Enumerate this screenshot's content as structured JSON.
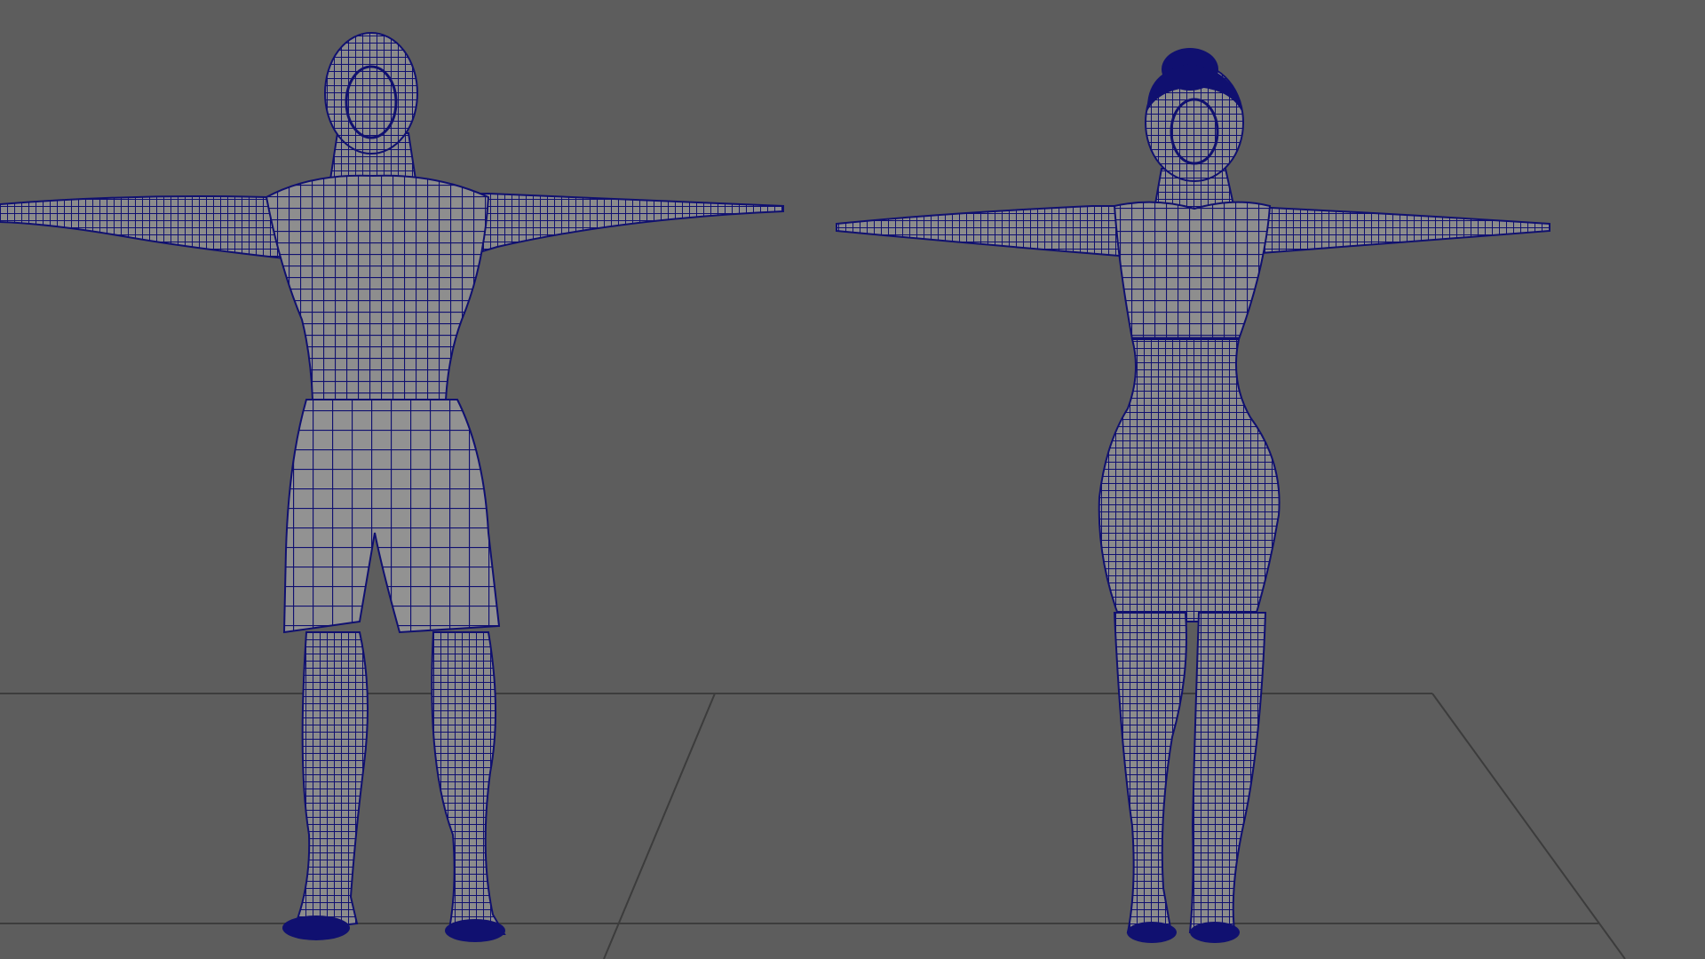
{
  "viewport": {
    "panel": "perspective-viewport",
    "display_mode": "wireframe-on-shaded",
    "background_color": "#5d5d5d",
    "grid_color": "#3c3c3c",
    "mesh_fill_color": "#8e8e8e",
    "wire_color": "#101070"
  },
  "scene": {
    "models": [
      {
        "id": "male-character",
        "pose": "T-pose",
        "clothing": "shorts"
      },
      {
        "id": "female-character",
        "pose": "T-pose",
        "clothing": "sports-top"
      }
    ],
    "ground_grid": {
      "visible": true
    }
  }
}
